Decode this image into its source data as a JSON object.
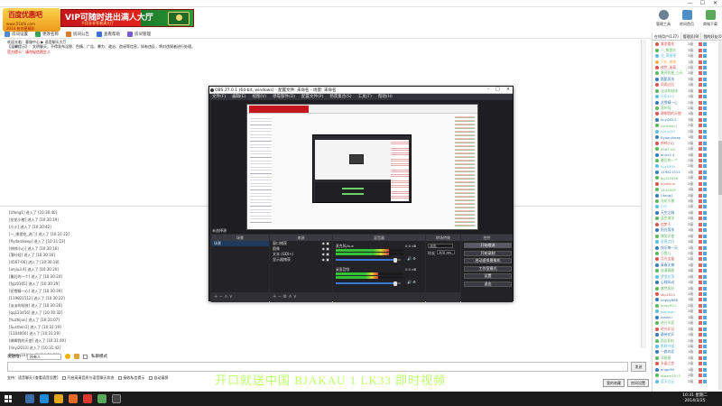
{
  "window": {
    "minimize": "—",
    "maximize": "☐",
    "close": "✕"
  },
  "logo": {
    "line1": "百度优惠吧",
    "line2": "www.51kfb.com",
    "line3": "2014 有你更精彩"
  },
  "vip_banner": {
    "title": "VIP可随时进出满人大厅",
    "subtitle": "不用非非等着满大厅"
  },
  "top_buttons": [
    {
      "label": "管理工具"
    },
    {
      "label": "房间首页"
    },
    {
      "label": "商城下载"
    }
  ],
  "toolbar": [
    {
      "label": "房间设置",
      "color": "#4b8ad8"
    },
    {
      "label": "更改名称",
      "color": "#3aa05a"
    },
    {
      "label": "房间公告",
      "color": "#e07a2a"
    },
    {
      "label": "查看帮助",
      "color": "#3a6fd8"
    },
    {
      "label": "房间管理",
      "color": "#7a5ad8"
    }
  ],
  "info_lines": [
    {
      "text": "欢迎光临：客服中心 ▶ 语音聊天大厅",
      "red": false
    },
    {
      "text": "【温馨提示】：文明聊天，不得发布淫秽、色情、广告、暴力、政治、造谣等信息，如有违反，将对违规者进行处理。",
      "red": false
    },
    {
      "text": "官方提示：请勿轻信陌生人",
      "red": true
    }
  ],
  "user_log": [
    "[Ufeng1] 进入了 [10:30:40]",
    "[花花小猪] 进入了 [10:30:19]",
    "[小小] 进入了 [10:30:42]",
    "[一_哪里吃_进门] 进入了 [10:31:22]",
    "[flydan/keep] 进入了 [10:31:23]",
    "[帅帅小心] 进入了 [10:30:16]",
    "[落叶轻] 进入了 [10:30:16]",
    "[4567-06] 进入了 [10:30:18]",
    "[anjiu3.4] 进入了 [10:30:20]",
    "[最后的一个] 进入了 [10:30:20]",
    "[fyjz0305] 进入了 [10:30:29]",
    "[花雪精一心] 进入了 [10:30:39]",
    "[119821512] 进入了 [10:30:22]",
    "[淡淡的轻快] 进入了 [10:30:26]",
    "[qq123456] 进入了 [10:30:32]",
    "[huzhijun] 进入了 [10:31:07]",
    "[Surzhen1] 进入了 [10:31:19]",
    "[1104000] 进入了 [10:31:29]",
    "[卿卿我的天使] 进入了 [10:31:40]",
    "[linyi2013] 进入了 [10:31:42]",
    "[Hunyj10] 进入了 [10:31:53]"
  ],
  "chat": {
    "target_label": "发送给：",
    "target_value": "所有人",
    "private_label": "私聊模式",
    "send_label": "发送"
  },
  "status_line": [
    "支持：语音聊天 [查看语音设置]",
    "开启高清音质与语音聊天状态",
    "接收私信提示",
    "自动滚屏"
  ],
  "watermark": "开口就送中国 BJAKAU 1 LK33 即时视频",
  "bottom_buttons": {
    "left": "我的收藏",
    "right": "房间设置"
  },
  "sidebar": {
    "tabs": [
      "在线用户(137)",
      "管理员(9)",
      "我的好友(0)"
    ],
    "users": [
      {
        "name": "雾里看花",
        "lvl": "2级",
        "color": "#d9534f"
      },
      {
        "name": "一_哪里吃",
        "lvl": "3级",
        "color": "#5cb85c"
      },
      {
        "name": "花_黑蜜枣",
        "lvl": "2级",
        "color": "#5bc0de"
      },
      {
        "name": "大花_美美",
        "lvl": "1级",
        "color": "#f0ad4e"
      },
      {
        "name": "夜色_迷离",
        "lvl": "2级",
        "color": "#d9534f"
      },
      {
        "name": "最亮的星_小天",
        "lvl": "2级",
        "color": "#5cb85c"
      },
      {
        "name": "酷酷男孩",
        "lvl": "3级",
        "color": "#337ab7"
      },
      {
        "name": "风雨过后",
        "lvl": "1级",
        "color": "#d9534f"
      },
      {
        "name": "淡淡的轻快",
        "lvl": "2级",
        "color": "#5cb85c"
      },
      {
        "name": "乐乐123",
        "lvl": "1级",
        "color": "#5bc0de"
      },
      {
        "name": "花雪精一心",
        "lvl": "2级",
        "color": "#337ab7"
      },
      {
        "name": "落叶轻",
        "lvl": "2级",
        "color": "#5cb85c"
      },
      {
        "name": "卿卿我的天使",
        "lvl": "1级",
        "color": "#d9534f"
      },
      {
        "name": "linyi2013",
        "lvl": "3级",
        "color": "#337ab7"
      },
      {
        "name": "sunzhen1",
        "lvl": "2级",
        "color": "#5cb85c"
      },
      {
        "name": "Hunyj10",
        "lvl": "2级",
        "color": "#5bc0de"
      },
      {
        "name": "flydan/keep",
        "lvl": "1级",
        "color": "#337ab7"
      },
      {
        "name": "帅帅小心",
        "lvl": "2级",
        "color": "#d9534f"
      },
      {
        "name": "4567-06",
        "lvl": "2级",
        "color": "#5cb85c"
      },
      {
        "name": "anjiu3.4",
        "lvl": "1级",
        "color": "#337ab7"
      },
      {
        "name": "最后的一个",
        "lvl": "2级",
        "color": "#5cb85c"
      },
      {
        "name": "fyjz0305",
        "lvl": "2级",
        "color": "#5bc0de"
      },
      {
        "name": "119821512",
        "lvl": "1级",
        "color": "#337ab7"
      },
      {
        "name": "qq123456",
        "lvl": "2级",
        "color": "#5cb85c"
      },
      {
        "name": "huzhijun",
        "lvl": "2级",
        "color": "#d9534f"
      },
      {
        "name": "1104000",
        "lvl": "1级",
        "color": "#5cb85c"
      },
      {
        "name": "Ufeng1",
        "lvl": "2级",
        "color": "#337ab7"
      },
      {
        "name": "花花小猪",
        "lvl": "3级",
        "color": "#5cb85c"
      },
      {
        "name": "小小",
        "lvl": "2级",
        "color": "#5bc0de"
      },
      {
        "name": "天空之城",
        "lvl": "1级",
        "color": "#337ab7"
      },
      {
        "name": "蓝色海洋",
        "lvl": "2级",
        "color": "#5cb85c"
      },
      {
        "name": "追梦人",
        "lvl": "2级",
        "color": "#d9534f"
      },
      {
        "name": "阳光男孩",
        "lvl": "1级",
        "color": "#337ab7"
      },
      {
        "name": "微笑天使",
        "lvl": "2级",
        "color": "#5cb85c"
      },
      {
        "name": "星星点灯",
        "lvl": "2级",
        "color": "#5bc0de"
      },
      {
        "name": "快乐每一天",
        "lvl": "1级",
        "color": "#337ab7"
      },
      {
        "name": "小鱼儿",
        "lvl": "2级",
        "color": "#5cb85c"
      },
      {
        "name": "月光宝盒",
        "lvl": "2级",
        "color": "#d9534f"
      },
      {
        "name": "青春无悔",
        "lvl": "1级",
        "color": "#337ab7"
      },
      {
        "name": "浪漫满屋",
        "lvl": "2级",
        "color": "#5cb85c"
      },
      {
        "name": "梦里花落",
        "lvl": "2级",
        "color": "#5bc0de"
      },
      {
        "name": "心随风动",
        "lvl": "1级",
        "color": "#337ab7"
      },
      {
        "name": "紫色风铃",
        "lvl": "2级",
        "color": "#5cb85c"
      },
      {
        "name": "sky2014",
        "lvl": "2级",
        "color": "#d9534f"
      },
      {
        "name": "happy888",
        "lvl": "1级",
        "color": "#337ab7"
      },
      {
        "name": "lucky521",
        "lvl": "2级",
        "color": "#5cb85c"
      },
      {
        "name": "wanwan",
        "lvl": "2级",
        "color": "#5bc0de"
      },
      {
        "name": "xiaoyu",
        "lvl": "1级",
        "color": "#337ab7"
      },
      {
        "name": "花开半夏",
        "lvl": "2级",
        "color": "#5cb85c"
      },
      {
        "name": "时光印记",
        "lvl": "2级",
        "color": "#d9534f"
      },
      {
        "name": "静待花开",
        "lvl": "1级",
        "color": "#337ab7"
      },
      {
        "name": "雨后彩虹",
        "lvl": "2级",
        "color": "#5cb85c"
      },
      {
        "name": "默默守候",
        "lvl": "2级",
        "color": "#5bc0de"
      },
      {
        "name": "一路向北",
        "lvl": "1级",
        "color": "#337ab7"
      },
      {
        "name": "北极星",
        "lvl": "2级",
        "color": "#5cb85c"
      },
      {
        "name": "水晶之恋",
        "lvl": "2级",
        "color": "#d9534f"
      },
      {
        "name": "angel99",
        "lvl": "1级",
        "color": "#337ab7"
      },
      {
        "name": "dream2013",
        "lvl": "2级",
        "color": "#5cb85c"
      },
      {
        "name": "蓝天白云",
        "lvl": "2级",
        "color": "#5bc0de"
      }
    ]
  },
  "taskbar": {
    "time": "10:31 星期二",
    "date": "2014/3/25"
  },
  "obs": {
    "title": "OBS 27.0.1 (64-bit, windows) - 配置文件: 未命名 - 场景: 未命名",
    "menu": [
      "文件(F)",
      "编辑(E)",
      "视图(V)",
      "停靠部件(D)",
      "配置文件(P)",
      "场景集合(S)",
      "工具(T)",
      "帮助(H)"
    ],
    "source_label": "未选择源",
    "docks": {
      "scenes": {
        "header": "场景",
        "items": [
          "场景"
        ]
      },
      "sources": {
        "header": "来源",
        "items": [
          "窗口捕获",
          "图像",
          "文本 (GDI+)",
          "显示器捕获"
        ]
      },
      "mixer": {
        "header": "混音器",
        "channels": [
          {
            "name": "麦克风/Aux",
            "db": "0.0 dB",
            "level": 0.78
          },
          {
            "name": "桌面音频",
            "db": "0.0 dB",
            "level": 0.62
          }
        ]
      },
      "transitions": {
        "header": "转场特效",
        "type": "淡出",
        "duration_label": "时长",
        "duration": "300 ms"
      },
      "controls": {
        "header": "控件",
        "buttons": [
          "开始推流",
          "开始录制",
          "启动虚拟摄像机",
          "工作室模式",
          "设置",
          "退出"
        ]
      }
    }
  }
}
